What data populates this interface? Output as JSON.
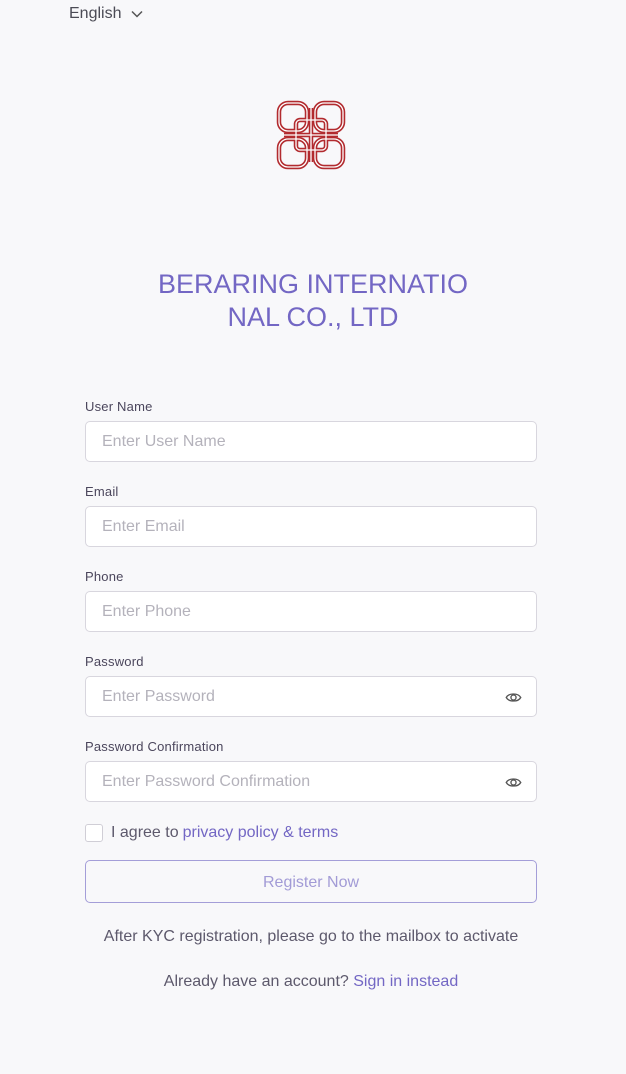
{
  "language": {
    "selected": "English"
  },
  "brand": {
    "line1": "BERARING INTERNATIO",
    "line2": "NAL CO., LTD",
    "color": "#7367c4"
  },
  "logo_color": "#b22b2f",
  "form": {
    "username": {
      "label": "User Name",
      "placeholder": "Enter User Name"
    },
    "email": {
      "label": "Email",
      "placeholder": "Enter Email"
    },
    "phone": {
      "label": "Phone",
      "placeholder": "Enter Phone"
    },
    "password": {
      "label": "Password",
      "placeholder": "Enter Password"
    },
    "password_confirmation": {
      "label": "Password Confirmation",
      "placeholder": "Enter Password Confirmation"
    },
    "agree_text": "I agree to",
    "agree_link": "privacy policy & terms",
    "register_label": "Register Now",
    "kyc_note": "After KYC registration, please go to the mailbox to activate",
    "have_account": "Already have an account?",
    "signin_link": "Sign in instead"
  },
  "icons": {
    "language_toggle": "chevron-down-icon",
    "show_password": "eye-icon",
    "logo": "knot-logo"
  }
}
